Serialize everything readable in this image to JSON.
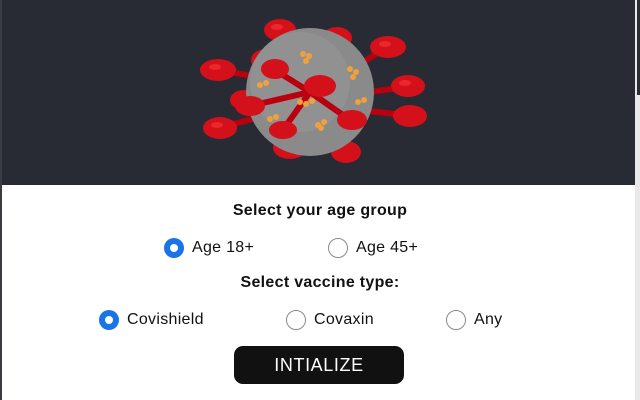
{
  "header": {
    "logo_icon": "coronavirus-icon",
    "colors": {
      "background": "#282b33",
      "virus_body": "#8a8a8a",
      "spike": "#d4101b",
      "dots": "#f0a03c"
    }
  },
  "age_group": {
    "title": "Select your age group",
    "options": [
      {
        "label": "Age 18+",
        "checked": true
      },
      {
        "label": "Age 45+",
        "checked": false
      }
    ]
  },
  "vaccine_type": {
    "title": "Select vaccine type:",
    "options": [
      {
        "label": "Covishield",
        "checked": true
      },
      {
        "label": "Covaxin",
        "checked": false
      },
      {
        "label": "Any",
        "checked": false
      }
    ]
  },
  "actions": {
    "initialize_label": "INTIALIZE"
  },
  "colors": {
    "accent": "#1a73e8",
    "button_bg": "#111111"
  }
}
